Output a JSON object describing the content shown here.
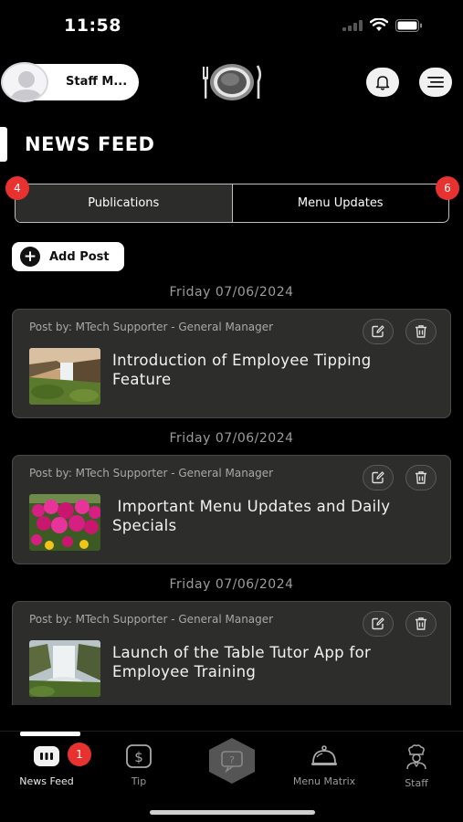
{
  "status": {
    "time": "11:58"
  },
  "header": {
    "staff_name": "Staff M...",
    "logo_icon": "plate-fork-knife-icon",
    "bell_icon": "bell-icon",
    "menu_icon": "hamburger-menu-icon"
  },
  "page": {
    "title": "NEWS FEED"
  },
  "tabs": [
    {
      "label": "Publications",
      "badge": "4",
      "active": true
    },
    {
      "label": "Menu Updates",
      "badge": "6",
      "active": false
    }
  ],
  "add_post": {
    "label": "Add Post"
  },
  "posts": [
    {
      "date": "Friday 07/06/2024",
      "author": "Post by: MTech Supporter - General Manager",
      "title": "Introduction of Employee Tipping Feature",
      "thumb": "waterfall-cliff-photo"
    },
    {
      "date": "Friday 07/06/2024",
      "author": "Post by: MTech Supporter - General Manager",
      "title": " Important Menu Updates and Daily Specials",
      "thumb": "pink-flowers-photo"
    },
    {
      "date": "Friday 07/06/2024",
      "author": "Post by: MTech Supporter - General Manager",
      "title": "Launch of the Table Tutor App for Employee Training",
      "thumb": "waterfall-canyon-photo"
    }
  ],
  "nav": {
    "news_feed": {
      "label": "News Feed",
      "badge": "1"
    },
    "tip": {
      "label": "Tip"
    },
    "center": {
      "icon": "question-chat-icon"
    },
    "menu_matrix": {
      "label": "Menu Matrix"
    },
    "staff": {
      "label": "Staff"
    }
  },
  "colors": {
    "badge": "#e8322f",
    "card": "#2d2d2b",
    "background": "#000000"
  }
}
